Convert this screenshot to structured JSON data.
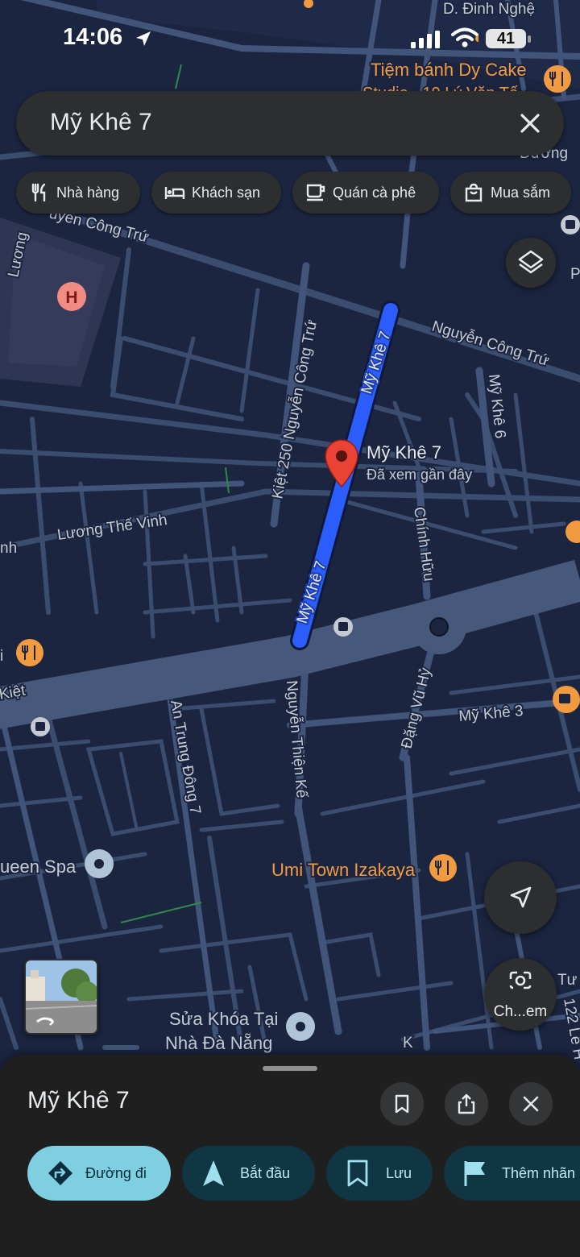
{
  "status_bar": {
    "time": "14:06",
    "battery": "41",
    "icons": [
      "location-arrow-icon",
      "cellular-signal-icon",
      "wifi-icon",
      "battery-icon"
    ]
  },
  "search": {
    "query": "Mỹ Khê 7",
    "clear_icon": "close-icon"
  },
  "chips": [
    {
      "label": "Nhà hàng",
      "icon": "restaurant-icon"
    },
    {
      "label": "Khách sạn",
      "icon": "hotel-icon"
    },
    {
      "label": "Quán cà phê",
      "icon": "coffee-icon"
    },
    {
      "label": "Mua sắm",
      "icon": "shopping-bag-icon"
    }
  ],
  "map": {
    "streets": {
      "dinh_nghe": "D. Đinh Nghệ",
      "nguyen_cong_tru_top": "uyen Công Trứ",
      "nguyen_cong_tru": "Nguyễn Công Trứ",
      "kiet_250": "Kiệt 250 Nguyễn Công Trứ",
      "my_khe_7_upper": "Mỹ Khê 7",
      "my_khe_7_lower": "Mỹ Khê 7",
      "my_khe_6": "Mỹ Khê 6",
      "luong_the_vinh": "Lương Thế Vinh",
      "chinh_huu": "Chính Hữu",
      "dang_vu_hy": "Đặng Vũ Hỷ",
      "my_khe_3": "Mỹ Khê 3",
      "nguyen_thien_ke": "Nguyễn Thiện Kế",
      "an_trung_dong_7": "An Trung Đông 7",
      "kiet_left": "Kiệt",
      "luong_left": "Lương",
      "duong_right": "Đường",
      "nh_left": "nh",
      "i_left": "i",
      "p_right": "P",
      "tu_right": "Tư",
      "le_right": "122 Lê H",
      "k_frag": "K"
    },
    "pois": {
      "cake_shop": "Tiệm bánh Dy Cake",
      "cake_shop_line2": "Studio - 19 Lý Văn Tố",
      "umi": "Umi Town Izakaya",
      "queen_spa": "ueen Spa",
      "key_shop_line1": "Sửa Khóa Tại",
      "key_shop_line2": "Nhà Đà Nẵng",
      "hospital_letter": "H"
    },
    "selected_place": {
      "name": "Mỹ Khê 7",
      "subtitle": "Đã xem gần đây"
    },
    "colors": {
      "background": "#1b2540",
      "road": "#3a4d6e",
      "main_road": "#46597a",
      "highlight": "#2a5dfb",
      "pin": "#ea4335",
      "poi_orange": "#f29a3f"
    }
  },
  "controls": {
    "layers_icon": "layers-icon",
    "navigation_icon": "navigation-arrow-icon",
    "lens_icon": "lens-camera-icon",
    "lens_label": "Ch...em"
  },
  "sheet": {
    "title": "Mỹ Khê 7",
    "buttons": [
      "bookmark-icon",
      "share-icon",
      "close-icon"
    ],
    "actions": [
      {
        "label": "Đường đi",
        "icon": "directions-icon"
      },
      {
        "label": "Bắt đầu",
        "icon": "navigation-icon"
      },
      {
        "label": "Lưu",
        "icon": "bookmark-icon"
      },
      {
        "label": "Thêm nhãn",
        "icon": "flag-icon"
      }
    ]
  }
}
